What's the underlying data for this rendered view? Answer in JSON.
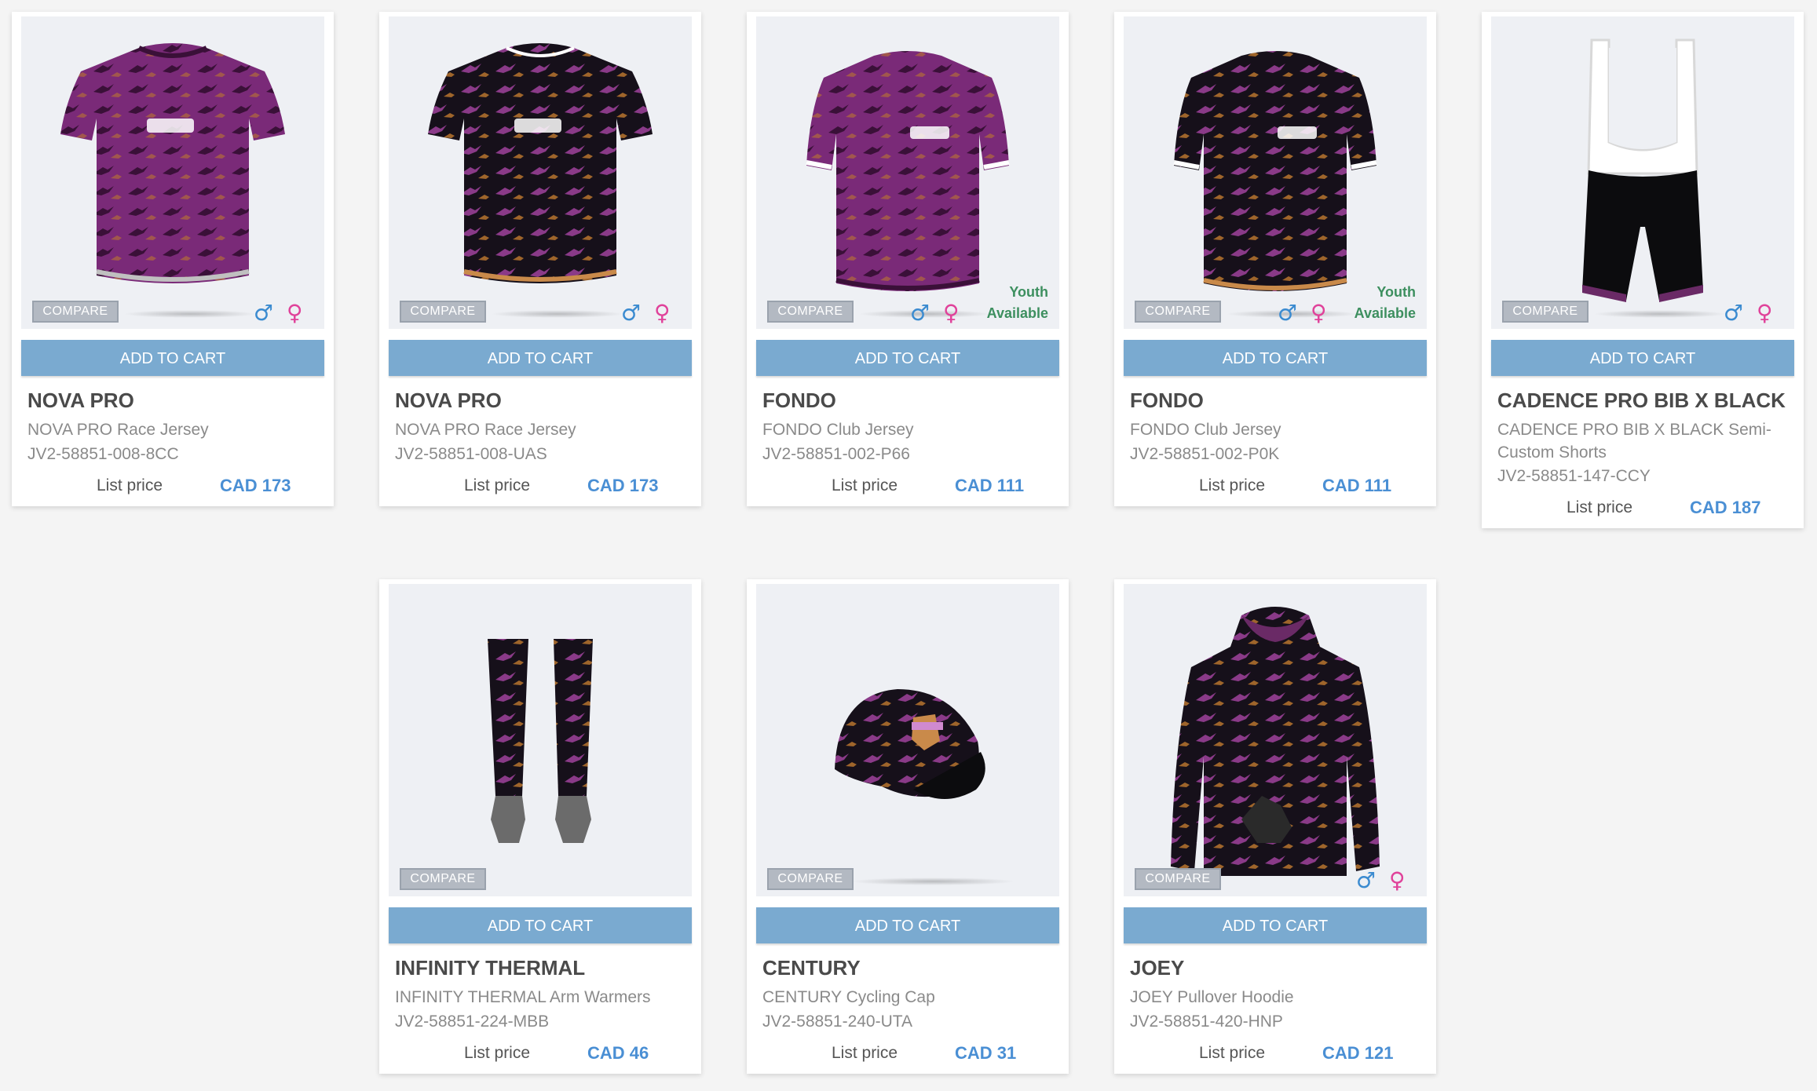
{
  "common": {
    "compare_label": "COMPARE",
    "add_to_cart_label": "ADD TO CART",
    "list_price_label": "List price",
    "youth_line1": "Youth",
    "youth_line2": "Available",
    "male_symbol": "♂",
    "female_symbol": "♀"
  },
  "colors": {
    "button_blue": "#7aaad0",
    "price_blue": "#4a8fd4",
    "youth_green": "#3d8f5f",
    "male_blue": "#3b8bd0",
    "female_pink": "#e0429a",
    "jersey_purple": "#7a2a78",
    "jersey_black": "#16101a"
  },
  "products": [
    {
      "name": "NOVA PRO",
      "description": "NOVA PRO Race Jersey",
      "sku": "JV2-58851-008-8CC",
      "price": "CAD 173",
      "image_icon": "purple-jersey-icon",
      "youth": false
    },
    {
      "name": "NOVA PRO",
      "description": "NOVA PRO Race Jersey",
      "sku": "JV2-58851-008-UAS",
      "price": "CAD 173",
      "image_icon": "black-jersey-icon",
      "youth": false
    },
    {
      "name": "FONDO",
      "description": "FONDO Club Jersey",
      "sku": "JV2-58851-002-P66",
      "price": "CAD 111",
      "image_icon": "purple-jersey-icon",
      "youth": true
    },
    {
      "name": "FONDO",
      "description": "FONDO Club Jersey",
      "sku": "JV2-58851-002-P0K",
      "price": "CAD 111",
      "image_icon": "black-jersey-icon",
      "youth": true
    },
    {
      "name": "CADENCE PRO BIB X BLACK",
      "description": "CADENCE PRO BIB X BLACK Semi-Custom Shorts",
      "sku": "JV2-58851-147-CCY",
      "price": "CAD 187",
      "image_icon": "bib-shorts-icon",
      "youth": false
    },
    {
      "name": "INFINITY THERMAL",
      "description": "INFINITY THERMAL Arm Warmers",
      "sku": "JV2-58851-224-MBB",
      "price": "CAD 46",
      "image_icon": "arm-warmers-icon",
      "youth": false
    },
    {
      "name": "CENTURY",
      "description": "CENTURY Cycling Cap",
      "sku": "JV2-58851-240-UTA",
      "price": "CAD 31",
      "image_icon": "cycling-cap-icon",
      "youth": false
    },
    {
      "name": "JOEY",
      "description": "JOEY Pullover Hoodie",
      "sku": "JV2-58851-420-HNP",
      "price": "CAD 121",
      "image_icon": "hoodie-icon",
      "youth": false
    }
  ]
}
